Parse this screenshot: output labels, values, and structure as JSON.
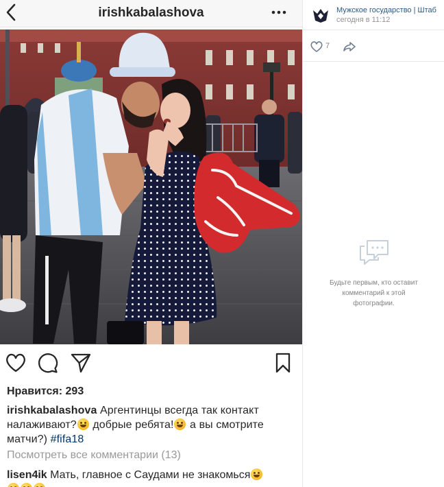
{
  "instagram": {
    "username": "irishkabalashova",
    "likes_text": "Нравится: 293",
    "caption": {
      "user": "irishkabalashova",
      "part1": " Аргентинцы всегда так контакт налаживают?",
      "part2": " добрые ребята!",
      "part3": " а вы смотрите матчи?) ",
      "hashtag": "#fifa18"
    },
    "view_all_comments": "Посмотреть все комментарии (13)",
    "comment": {
      "user": "lisen4ik",
      "text": " Мать, главное с Саудами не знакомься"
    },
    "icons": {
      "back": "chevron-left-icon",
      "more": "more-horizontal-icon",
      "like": "heart-icon",
      "comment": "comment-icon",
      "share": "send-icon",
      "save": "bookmark-icon"
    },
    "colors": {
      "header_bg": "#f7f7f7",
      "text": "#262626",
      "muted": "#999999",
      "hashtag": "#003569"
    }
  },
  "vk": {
    "author": "Мужское государство | Штаб",
    "time": "сегодня в 11:12",
    "likes": "7",
    "empty_text": "Будьте первым, кто оставит комментарий к этой фотографии.",
    "icons": {
      "avatar": "community-logo-icon",
      "like": "heart-icon",
      "share": "share-arrow-icon",
      "empty": "speech-bubbles-icon"
    },
    "colors": {
      "link": "#2a5885",
      "muted": "#939393",
      "border": "#e7e8ec"
    }
  }
}
